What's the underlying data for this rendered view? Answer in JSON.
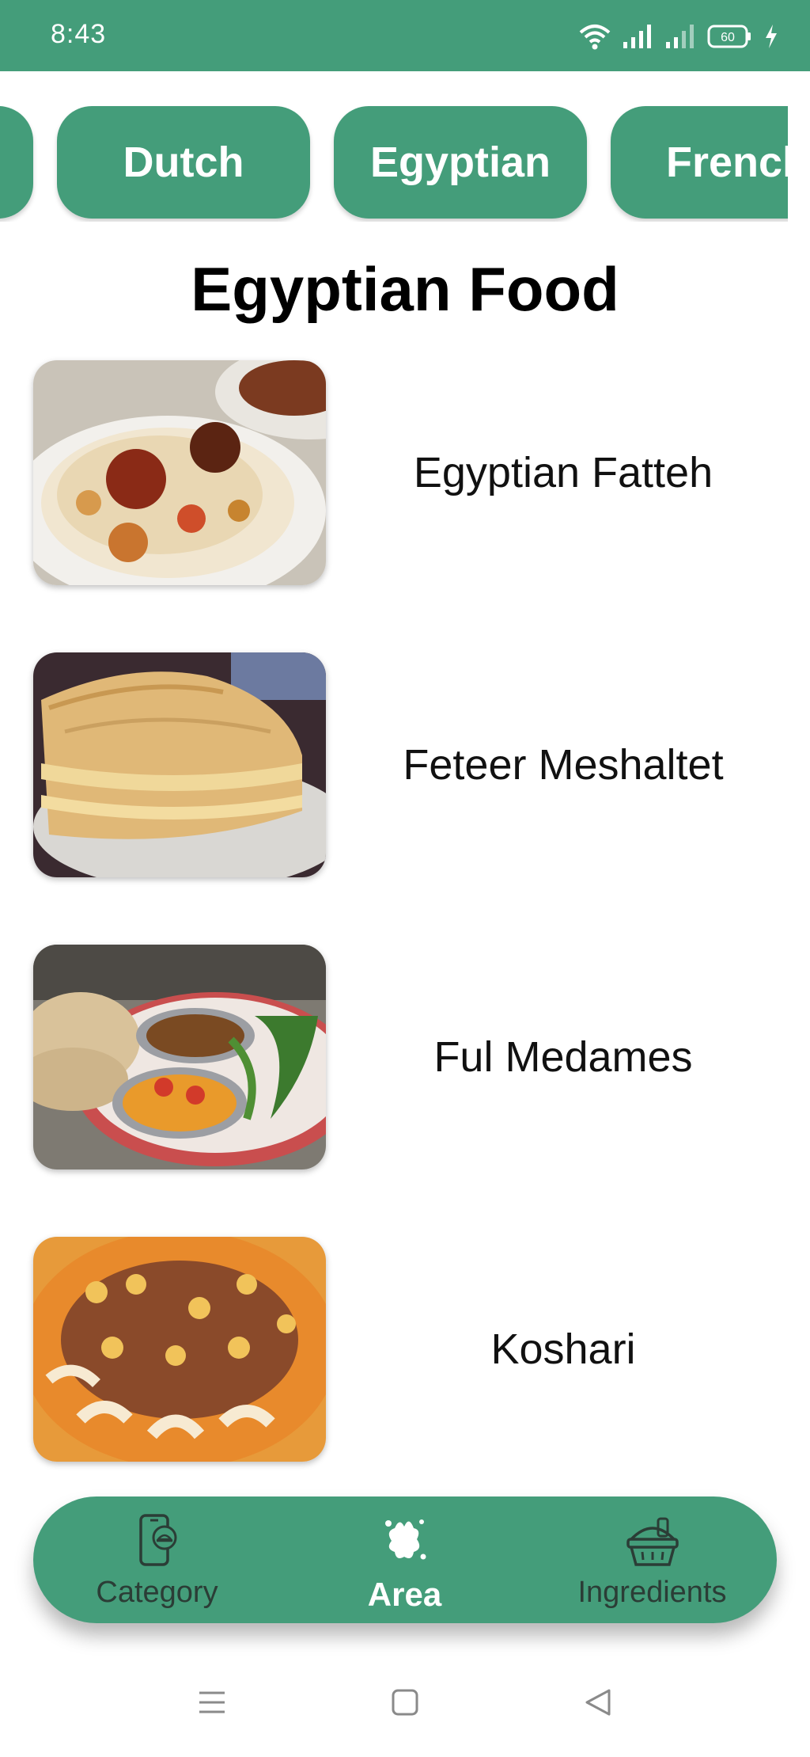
{
  "status": {
    "time": "8:43",
    "battery": "60",
    "icons": [
      "wifi-icon",
      "signal-icon",
      "signal-weak-icon",
      "battery-icon",
      "charging-icon"
    ]
  },
  "areas": {
    "items": [
      "",
      "Dutch",
      "Egyptian",
      "French"
    ],
    "selected": "Egyptian"
  },
  "page": {
    "title": "Egyptian Food"
  },
  "meals": [
    {
      "name": "Egyptian Fatteh"
    },
    {
      "name": "Feteer Meshaltet"
    },
    {
      "name": "Ful Medames"
    },
    {
      "name": "Koshari"
    }
  ],
  "bottom_nav": {
    "items": [
      {
        "label": "Category",
        "icon": "phone-food-icon",
        "active": false
      },
      {
        "label": "Area",
        "icon": "area-splash-icon",
        "active": true
      },
      {
        "label": "Ingredients",
        "icon": "grocery-basket-icon",
        "active": false
      }
    ]
  },
  "system_nav": [
    "menu-icon",
    "home-icon",
    "back-icon"
  ],
  "colors": {
    "primary": "#449d7a",
    "nav_inactive_text": "#2b3d36"
  }
}
